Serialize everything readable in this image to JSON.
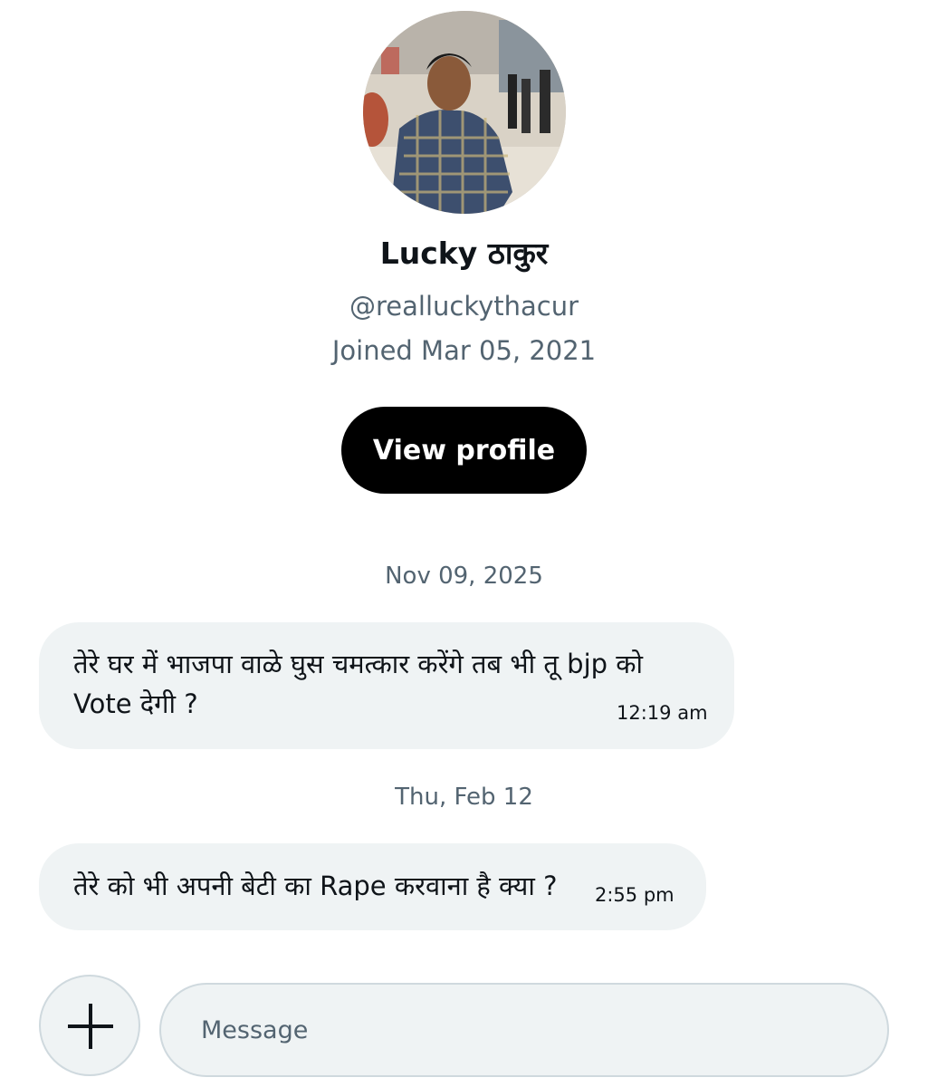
{
  "profile": {
    "name": "Lucky ठाकुर",
    "handle": "@realluckythacur",
    "joined": "Joined Mar 05, 2021",
    "view_profile_label": "View profile"
  },
  "conversation": {
    "groups": [
      {
        "date": "Nov 09, 2025",
        "messages": [
          {
            "line1": "तेरे घर में भाजपा वाळे  घुस चमत्कार करेंगे तब भी तू bjp को",
            "line2": "Vote देगी ?",
            "time": "12:19 am"
          }
        ]
      },
      {
        "date": "Thu, Feb 12",
        "messages": [
          {
            "line1": "तेरे को भी अपनी बेटी का Rape करवाना है क्या ?",
            "time": "2:55 pm"
          }
        ]
      }
    ]
  },
  "composer": {
    "placeholder": "Message"
  },
  "icons": {
    "add": "plus-icon"
  },
  "colors": {
    "bubble_bg": "#eff3f4",
    "secondary_text": "#536471",
    "button_bg": "#000000"
  }
}
